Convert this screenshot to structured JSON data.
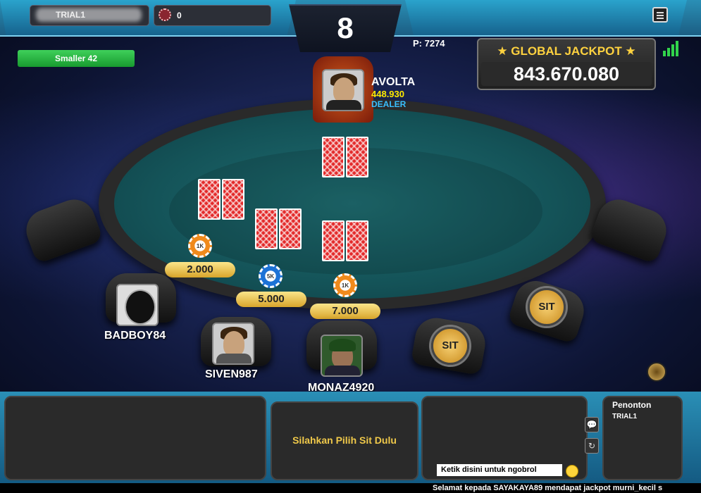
{
  "topbar": {
    "username": "TRIAL1",
    "chip_count": "0",
    "counter": "8",
    "p_label": "P: 7274"
  },
  "status_button": "Smaller 42",
  "jackpot": {
    "title": "★ GLOBAL JACKPOT ★",
    "value": "843.670.080"
  },
  "dealer": {
    "name": "AVOLTA",
    "chips": "448.930",
    "role": "DEALER"
  },
  "players": [
    {
      "name": "BADBOY84"
    },
    {
      "name": "SIVEN987"
    },
    {
      "name": "MONAZ4920"
    }
  ],
  "bets": [
    "2.000",
    "5.000",
    "7.000"
  ],
  "chips": [
    "1K",
    "5K",
    "1K"
  ],
  "sit_label": "SIT",
  "bottom": {
    "center_message": "Silahkan Pilih Sit Dulu",
    "chat_placeholder": "Ketik disini untuk ngobrol",
    "spectators_title": "Penonton",
    "spectators": [
      "TRIAL1"
    ]
  },
  "ticker": "Selamat kepada SAYAKAYA89 mendapat jackpot murni_kecil s",
  "colors": {
    "felt": "#145358",
    "jackpot_title": "#ffd23f",
    "dealer_chips": "#ffea00",
    "dealer_role": "#39c0ff",
    "status_green": "#31d44b"
  }
}
